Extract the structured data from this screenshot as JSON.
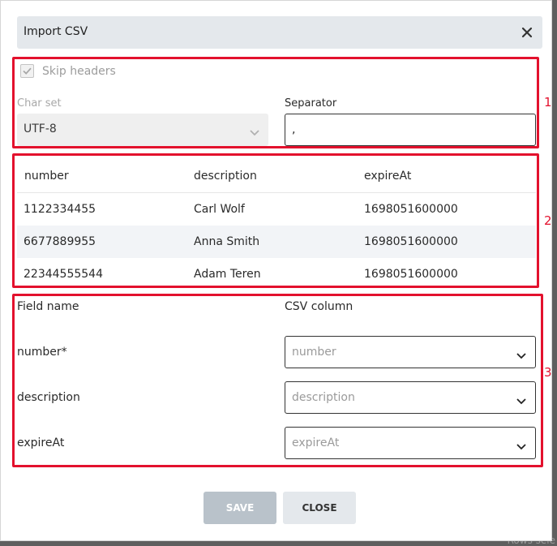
{
  "dialog": {
    "title": "Import CSV"
  },
  "section1": {
    "skip_headers_label": "Skip headers",
    "skip_headers_checked": true,
    "charset_label": "Char set",
    "charset_value": "UTF-8",
    "separator_label": "Separator",
    "separator_value": ","
  },
  "preview": {
    "headers": [
      "number",
      "description",
      "expireAt"
    ],
    "rows": [
      [
        "1122334455",
        "Carl Wolf",
        "1698051600000"
      ],
      [
        "6677889955",
        "Anna Smith",
        "1698051600000"
      ],
      [
        "22344555544",
        "Adam Teren",
        "1698051600000"
      ]
    ]
  },
  "mapping": {
    "field_name_header": "Field name",
    "csv_column_header": "CSV column",
    "rows": [
      {
        "field": "number*",
        "column": "number"
      },
      {
        "field": "description",
        "column": "description"
      },
      {
        "field": "expireAt",
        "column": "expireAt"
      }
    ]
  },
  "markers": [
    "1",
    "2",
    "3"
  ],
  "footer": {
    "save_label": "SAVE",
    "close_label": "CLOSE"
  },
  "background": {
    "hint_text": "Rows sele"
  },
  "colors": {
    "highlight": "#e3112d",
    "header_bg": "#e4e8ec",
    "save_disabled": "#b9c2ca"
  }
}
